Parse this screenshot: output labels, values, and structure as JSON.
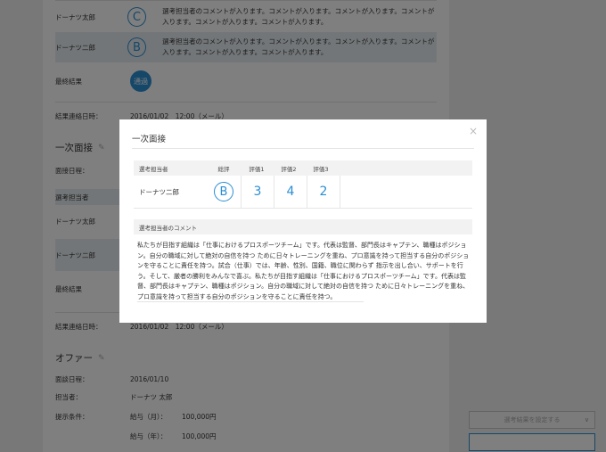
{
  "background": {
    "rows_top": [
      {
        "label": "ドーナツ太郎",
        "grade": "C",
        "comment": "選考担当者のコメントが入ります。コメントが入ります。コメントが入ります。コメントが入ります。コメントが入ります。コメントが入ります。"
      },
      {
        "label": "ドーナツ二郎",
        "grade": "B",
        "comment": "選考担当者のコメントが入ります。コメントが入ります。コメントが入ります。コメントが入ります。コメントが入ります。コメントが入ります。"
      }
    ],
    "final_result_label": "最終結果",
    "final_result_value": "通過",
    "result_date_label": "結果連絡日時：",
    "result_date_value": "2016/01/02　12:00（メール）",
    "interview_section_title": "一次面接",
    "interview_date_label": "面接日程：",
    "interviewer_label": "選考担当者",
    "interviewer_1": "ドーナツ太郎",
    "interviewer_2": "ドーナツ二郎",
    "final_result_label_2": "最終結果",
    "result_date_label_2": "結果連絡日時：",
    "result_date_value_2": "2016/01/02　12:00（メール）",
    "offer_section_title": "オファー",
    "offer_date_label": "面談日程：",
    "offer_date_value": "2016/01/10",
    "person_label": "担当者：",
    "person_value": "ドーナツ 太郎",
    "conditions_label": "提示条件：",
    "salary_month_label": "給与（月）：",
    "salary_month_value": "100,000円",
    "salary_year_label": "給与（年）：",
    "salary_year_value": "100,000円"
  },
  "controls": {
    "select_placeholder": "選考結果を設定する",
    "select_chevron": "chevron-down-icon"
  },
  "modal": {
    "title": "一次面接",
    "close_icon": "×",
    "table": {
      "headers": [
        "選考担当者",
        "総評",
        "評価1",
        "評価2",
        "評価3"
      ],
      "row": {
        "name": "ドーナツ二郎",
        "grade": "B",
        "scores": [
          "3",
          "4",
          "2"
        ]
      }
    },
    "comment_header": "選考担当者のコメント",
    "comment_body": "私たちが目指す組織は「仕事におけるプロスポーツチーム」です。代表は監督、部門長はキャプテン、職種はポジション。自分の職域に対して絶対の自信を持つ ために日々トレーニングを重ね、プロ意識を持って担当する自分のポジションを守ることに責任を持つ。試合（仕事）では、年齢、性別、国籍、職位に関わらず 指示を出し合い、サポートを行う。そして、厳者の勝利をみんなで喜ぶ。私たちが目指す組織は「仕事におけるプロスポーツチーム」です。代表は監督、部門長はキャプテン、職種はポジション。自分の職域に対して絶対の自信を持つ ために日々トレーニングを重ね、プロ意識を持って担当する自分のポジションを守ることに責任を持つ。"
  },
  "colors": {
    "accent": "#2b8ed3",
    "overlay": "rgba(0,0,0,0.5)"
  }
}
